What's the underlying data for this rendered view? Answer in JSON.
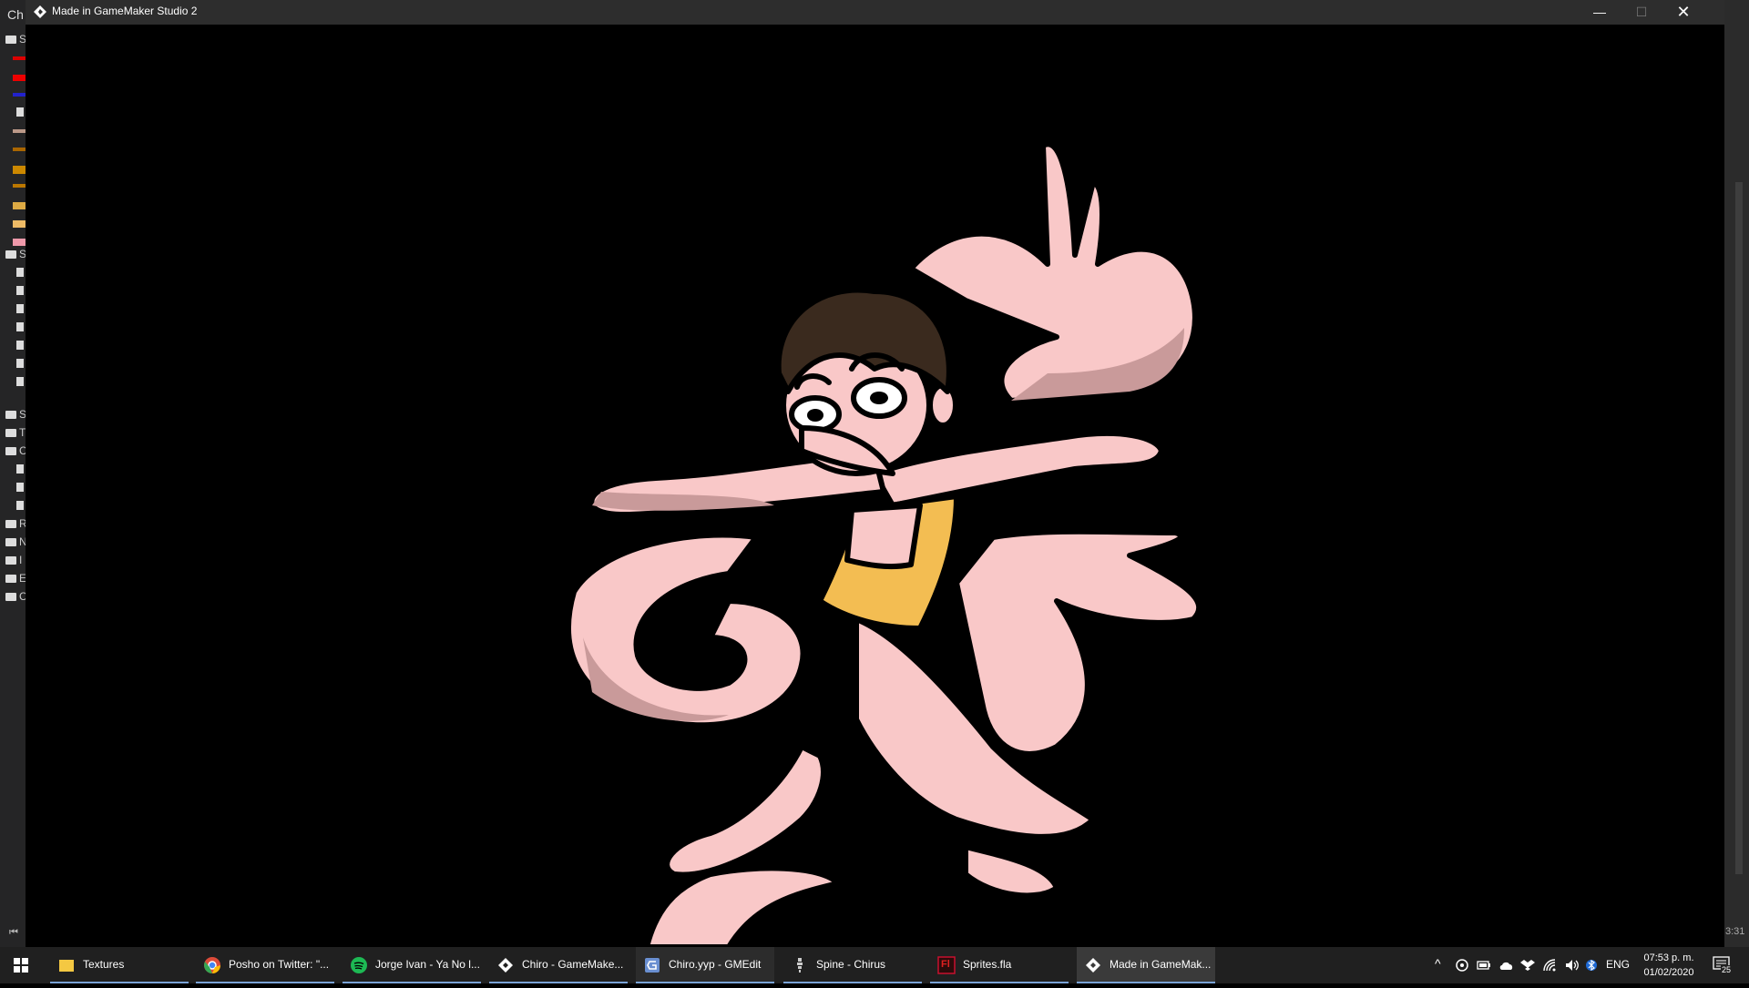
{
  "background_ide": {
    "title_fragment": "Ch",
    "tree_letters": [
      "S",
      "S",
      "S",
      "T",
      "C",
      "R",
      "N",
      "I",
      "E",
      "C"
    ],
    "right_time_fragment": "3:31"
  },
  "game_window": {
    "title": "Made in GameMaker Studio 2",
    "min_glyph": "—",
    "max_glyph": "☐",
    "close_glyph": "✕",
    "scene": {
      "character": "pink multi-armed character with brown hair and yellow shirt",
      "colors": {
        "skin": "#f9c8c8",
        "shade": "#c99a9a",
        "hair": "#3a2a1e",
        "shirt": "#f3bd52",
        "outline": "#000000",
        "background": "#000000"
      }
    }
  },
  "taskbar": {
    "start_icon": "windows-start-icon",
    "items": [
      {
        "label": "Textures",
        "icon": "folder-icon",
        "color": "#f4c842"
      },
      {
        "label": "Posho on Twitter: \"...",
        "icon": "chrome-icon",
        "color": "#dd4b39"
      },
      {
        "label": "Jorge Ivan - Ya No l...",
        "icon": "spotify-icon",
        "color": "#1db954"
      },
      {
        "label": "Chiro - GameMake...",
        "icon": "gamemaker-icon",
        "color": "#ffffff"
      },
      {
        "label": "Chiro.yyp - GMEdit",
        "icon": "gmedit-icon",
        "color": "#6a8fd1"
      },
      {
        "label": "Spine - Chirus",
        "icon": "spine-icon",
        "color": "#cccccc"
      },
      {
        "label": "Sprites.fla",
        "icon": "flash-icon",
        "color": "#c8102e",
        "icon_text": "Fl"
      },
      {
        "label": "Made in GameMak...",
        "icon": "gamemaker-icon",
        "color": "#ffffff"
      }
    ],
    "active_index": 7,
    "tray": {
      "chevron": "^",
      "language": "ENG",
      "time": "07:53 p. m.",
      "date": "01/02/2020",
      "notification_count": "25"
    }
  }
}
